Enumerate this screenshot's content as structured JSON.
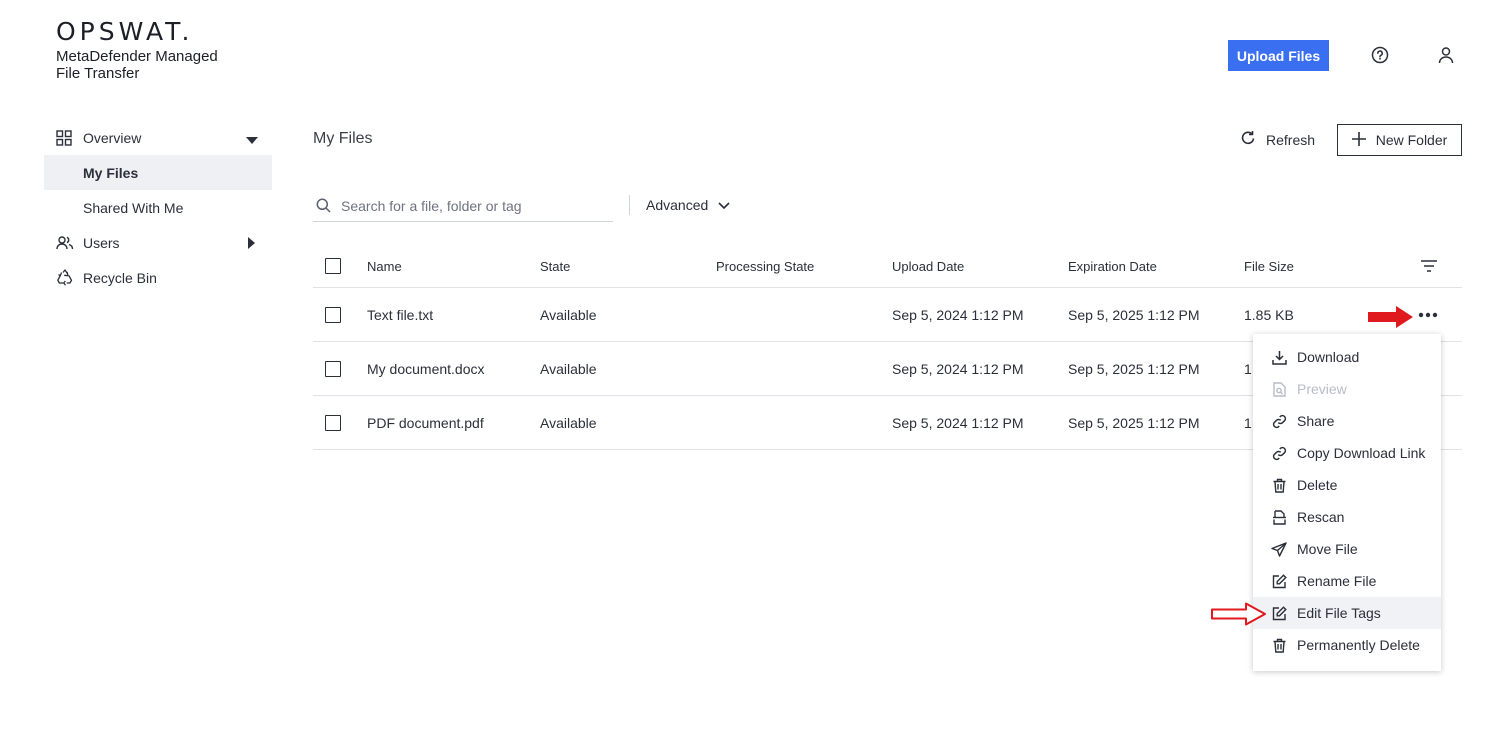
{
  "brand": {
    "logo": "OPSWAT.",
    "product": "MetaDefender Managed File Transfer"
  },
  "header": {
    "upload_label": "Upload Files"
  },
  "sidebar": {
    "items": [
      {
        "label": "Overview"
      },
      {
        "label": "My Files"
      },
      {
        "label": "Shared With Me"
      },
      {
        "label": "Users"
      },
      {
        "label": "Recycle Bin"
      }
    ]
  },
  "main": {
    "title": "My Files",
    "refresh_label": "Refresh",
    "new_folder_label": "New Folder",
    "search_placeholder": "Search for a file, folder or tag",
    "advanced_label": "Advanced"
  },
  "table": {
    "columns": [
      "Name",
      "State",
      "Processing State",
      "Upload Date",
      "Expiration Date",
      "File Size"
    ],
    "rows": [
      {
        "name": "Text file.txt",
        "state": "Available",
        "processing": "",
        "upload": "Sep 5, 2024 1:12 PM",
        "expiration": "Sep 5, 2025 1:12 PM",
        "size": "1.85 KB"
      },
      {
        "name": "My document.docx",
        "state": "Available",
        "processing": "",
        "upload": "Sep 5, 2024 1:12 PM",
        "expiration": "Sep 5, 2025 1:12 PM",
        "size": "1"
      },
      {
        "name": "PDF document.pdf",
        "state": "Available",
        "processing": "",
        "upload": "Sep 5, 2024 1:12 PM",
        "expiration": "Sep 5, 2025 1:12 PM",
        "size": "1"
      }
    ]
  },
  "menu": {
    "items": [
      {
        "label": "Download",
        "icon": "download-icon"
      },
      {
        "label": "Preview",
        "icon": "preview-icon",
        "disabled": true
      },
      {
        "label": "Share",
        "icon": "link-icon"
      },
      {
        "label": "Copy Download Link",
        "icon": "link-icon"
      },
      {
        "label": "Delete",
        "icon": "trash-icon"
      },
      {
        "label": "Rescan",
        "icon": "rescan-icon"
      },
      {
        "label": "Move File",
        "icon": "send-icon"
      },
      {
        "label": "Rename File",
        "icon": "edit-icon"
      },
      {
        "label": "Edit File Tags",
        "icon": "edit-icon",
        "highlighted": true
      },
      {
        "label": "Permanently Delete",
        "icon": "trash-icon"
      }
    ]
  },
  "colors": {
    "accent": "#3a6ff2",
    "annotation": "#e0191f"
  }
}
